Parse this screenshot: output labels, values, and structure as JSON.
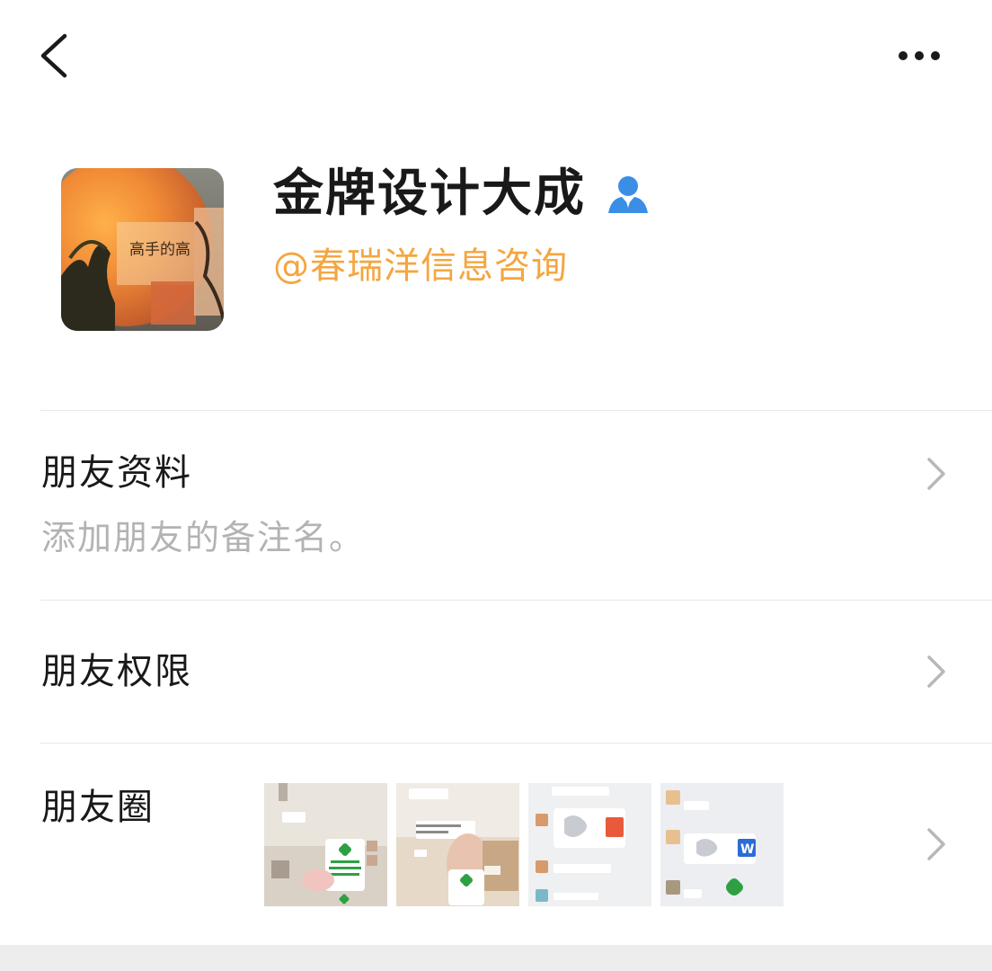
{
  "header": {
    "back_icon": "chevron-left-icon",
    "more_icon": "more-dots-icon"
  },
  "profile": {
    "avatar_icon": "avatar-image",
    "nickname": "金牌设计大成",
    "verified_icon": "person-icon",
    "company": "@春瑞洋信息咨询"
  },
  "rows": {
    "profile_info": {
      "title": "朋友资料",
      "subtitle": "添加朋友的备注名。"
    },
    "permissions": {
      "title": "朋友权限"
    },
    "moments": {
      "title": "朋友圈",
      "thumbnails": [
        "moment-thumbnail-1",
        "moment-thumbnail-2",
        "moment-thumbnail-3",
        "moment-thumbnail-4"
      ]
    }
  },
  "colors": {
    "accent_orange": "#f4a640",
    "verified_blue": "#3a8ee6",
    "text_primary": "#191919",
    "text_secondary": "#b3b3b3",
    "divider": "#e8e8e8",
    "bottom_bar": "#ededed"
  }
}
